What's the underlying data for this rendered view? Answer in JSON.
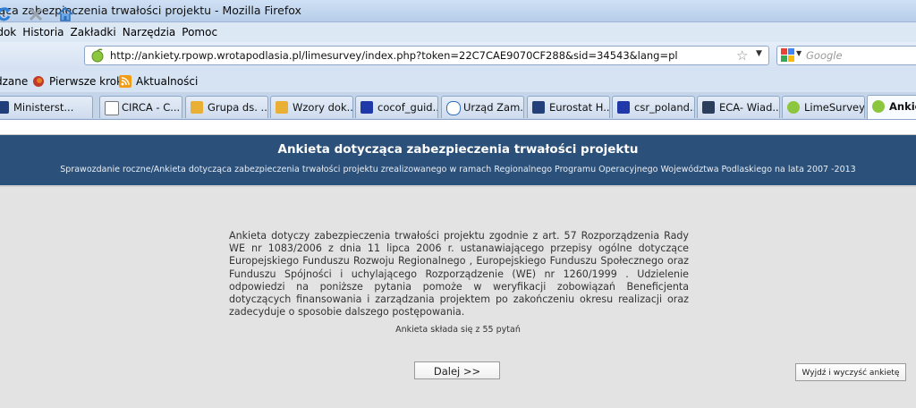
{
  "window": {
    "title": "ząca zabezpieczenia trwałości projektu - Mozilla Firefox"
  },
  "menu": [
    "idok",
    "Historia",
    "Zakładki",
    "Narzędzia",
    "Pomoc"
  ],
  "nav": {
    "url": "http://ankiety.rpowp.wrotapodlasia.pl/limesurvey/index.php?token=22C7CAE9070CF288&sid=34543&lang=pl",
    "search_placeholder": "Google"
  },
  "bookmarks": [
    "dzane",
    "Pierwsze kroki",
    "Aktualności"
  ],
  "tabs": [
    {
      "label": "Ministerst...",
      "icon": "mrr-icon"
    },
    {
      "label": "CIRCA - C...",
      "icon": "page-icon"
    },
    {
      "label": "Grupa ds. ...",
      "icon": "puzzle-icon"
    },
    {
      "label": "Wzory dok...",
      "icon": "puzzle-icon"
    },
    {
      "label": "cocof_guid...",
      "icon": "eu-flag-icon"
    },
    {
      "label": "Urząd Zam...",
      "icon": "at-icon"
    },
    {
      "label": "Eurostat H...",
      "icon": "eurostat-icon"
    },
    {
      "label": "csr_poland...",
      "icon": "eu-flag-icon"
    },
    {
      "label": "ECA- Wiad...",
      "icon": "book-icon"
    },
    {
      "label": "LimeSurvey",
      "icon": "lime-icon"
    },
    {
      "label": "Ankie",
      "icon": "lime-icon"
    }
  ],
  "survey": {
    "title": "Ankieta dotycząca zabezpieczenia trwałości projektu",
    "subtitle": "Sprawozdanie roczne/Ankieta dotycząca zabezpieczenia trwałości projektu zrealizowanego w ramach Regionalnego Programu Operacyjnego Województwa Podlaskiego na lata 2007 -2013",
    "intro": "Ankieta dotyczy zabezpieczenia trwałości projektu zgodnie z art. 57 Rozporządzenia Rady WE nr 1083/2006 z dnia 11 lipca 2006 r. ustanawiającego przepisy ogólne dotyczące Europejskiego Funduszu Rozwoju Regionalnego , Europejskiego Funduszu Społecznego oraz Funduszu Spójności i uchylającego Rozporządzenie (WE) nr 1260/1999 . Udzielenie odpowiedzi na poniższe pytania pomoże w weryfikacji zobowiązań Beneficjenta dotyczących finansowania i zarządzania projektem po zakończeniu okresu realizacji oraz zadecyduje o sposobie dalszego postępowania.",
    "question_count": "Ankieta składa się z 55 pytań",
    "next_label": "Dalej >>",
    "exit_label": "Wyjdź i wyczyść ankietę"
  },
  "colors": {
    "header_bg": "#2b5079",
    "page_bg": "#e3e3e3"
  }
}
